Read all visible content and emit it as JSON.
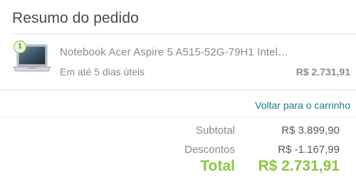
{
  "order_summary": {
    "title": "Resumo do pedido",
    "item": {
      "quantity": "1",
      "name": "Notebook Acer Aspire 5 A515-52G-79H1 Intel…",
      "delivery": "Em até 5 dias úteis",
      "price": "R$ 2.731,91",
      "thumbnail_icon": "laptop-icon"
    },
    "back_link": "Voltar para o carrinho",
    "subtotal_label": "Subtotal",
    "subtotal_value": "R$ 3.899,90",
    "discount_label": "Descontos",
    "discount_value": "R$ -1.167,99",
    "total_label": "Total",
    "total_value": "R$ 2.731,91"
  },
  "colors": {
    "accent_green": "#8cc63f",
    "link_teal": "#1d7b89",
    "muted_text": "#8a8a8a",
    "divider": "#e2e2e2"
  }
}
